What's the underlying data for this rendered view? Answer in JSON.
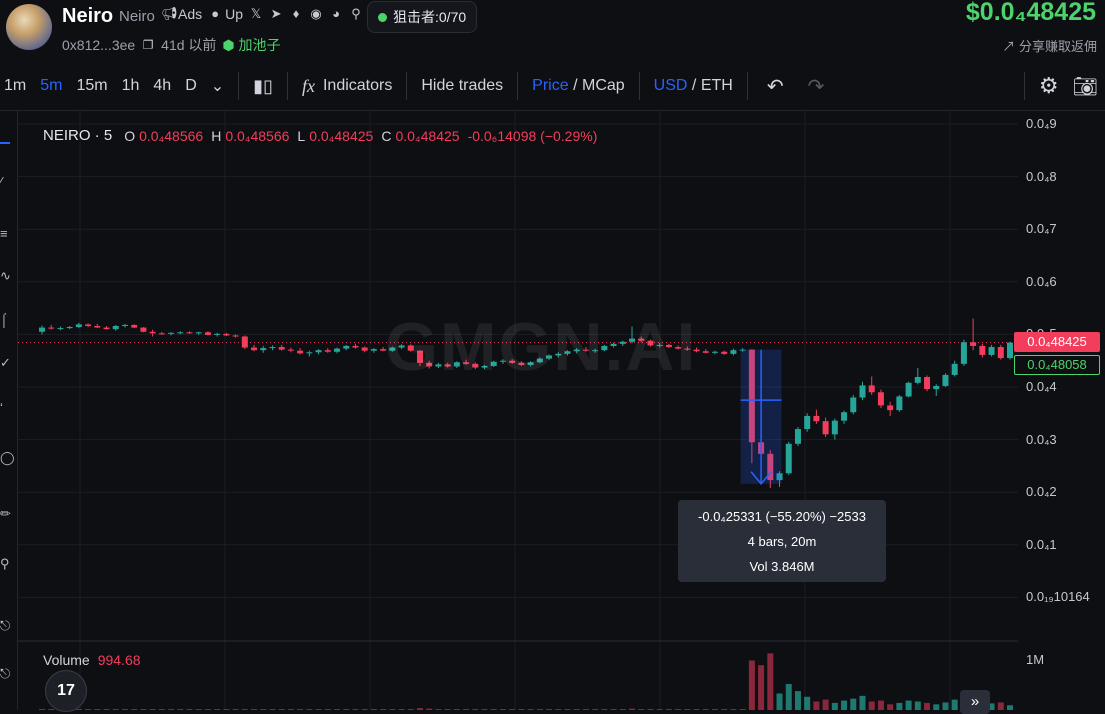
{
  "header": {
    "token_name": "Neiro",
    "token_sub": "Neiro",
    "links": [
      {
        "label": "Ads",
        "icon": "megaphone-icon"
      },
      {
        "label": "Up",
        "icon": "people-icon"
      },
      {
        "label": "",
        "icon": "x-logo-icon"
      },
      {
        "label": "",
        "icon": "telegram-icon"
      },
      {
        "label": "",
        "icon": "tag-icon"
      },
      {
        "label": "",
        "icon": "eye-icon"
      },
      {
        "label": "",
        "icon": "chrome-icon"
      },
      {
        "label": "",
        "icon": "search-icon"
      }
    ],
    "sniper": "狙击者:0/70",
    "address": "0x812...3ee",
    "age": "41d 以前",
    "pool": "加池子",
    "price": "$0.0₄48425",
    "share": "分享赚取返佣"
  },
  "toolbar": {
    "intervals": [
      "1m",
      "5m",
      "15m",
      "1h",
      "4h",
      "D"
    ],
    "active_interval": "5m",
    "indicators": "Indicators",
    "hide_trades": "Hide trades",
    "price": "Price",
    "mcap": "MCap",
    "usd": "USD",
    "eth": "ETH",
    "slash": "/"
  },
  "legend": {
    "symbol": "NEIRO · 5",
    "o_label": "O",
    "o": "0.0₄48566",
    "h_label": "H",
    "h": "0.0₄48566",
    "l_label": "L",
    "l": "0.0₄48425",
    "c_label": "C",
    "c": "0.0₄48425",
    "change": "-0.0₆14098 (−0.29%)"
  },
  "price_tag": "0.0₄48425",
  "price_tag2": "0.0₄48058",
  "tooltip": {
    "line1": "-0.0₄25331 (−55.20%) −2533",
    "line2": "4 bars, 20m",
    "line3": "Vol 3.846M"
  },
  "watermark": "GMGN.AI",
  "volume": {
    "label": "Volume",
    "value": "994.68",
    "axis": "1M"
  },
  "tv_logo": "17",
  "colors": {
    "up": "#26a69a",
    "down": "#f23d5c",
    "accent": "#2962ff",
    "green_text": "#4cd36b"
  },
  "chart_data": {
    "type": "candlestick",
    "y_ticks": [
      "0.0₄9",
      "0.0₄8",
      "0.0₄7",
      "0.0₄6",
      "0.0₄5",
      "0.0₄4",
      "0.0₄3",
      "0.0₄2",
      "0.0₄1",
      "0.0₁₉10164"
    ],
    "ylim": [
      0.0,
      9e-05
    ],
    "candles": [
      [
        50.5,
        51.7,
        50.0,
        51.3
      ],
      [
        51.3,
        51.8,
        50.9,
        51.1
      ],
      [
        51.1,
        51.5,
        50.8,
        51.2
      ],
      [
        51.2,
        51.6,
        51.0,
        51.4
      ],
      [
        51.4,
        52.2,
        51.2,
        51.9
      ],
      [
        51.9,
        52.1,
        51.4,
        51.6
      ],
      [
        51.6,
        52.0,
        51.2,
        51.3
      ],
      [
        51.3,
        51.6,
        50.9,
        51.0
      ],
      [
        51.0,
        51.8,
        50.7,
        51.6
      ],
      [
        51.6,
        52.0,
        51.3,
        51.8
      ],
      [
        51.8,
        51.9,
        51.2,
        51.3
      ],
      [
        51.3,
        51.4,
        50.4,
        50.5
      ],
      [
        50.5,
        50.9,
        49.6,
        50.2
      ],
      [
        50.2,
        50.5,
        49.9,
        50.1
      ],
      [
        50.1,
        50.4,
        49.8,
        50.3
      ],
      [
        50.3,
        50.6,
        50.0,
        50.4
      ],
      [
        50.4,
        50.6,
        50.1,
        50.2
      ],
      [
        50.2,
        50.5,
        49.9,
        50.4
      ],
      [
        50.4,
        50.6,
        49.8,
        49.9
      ],
      [
        49.9,
        50.3,
        49.6,
        50.1
      ],
      [
        50.1,
        50.3,
        49.7,
        49.8
      ],
      [
        49.8,
        50.0,
        49.4,
        49.6
      ],
      [
        49.6,
        49.8,
        47.2,
        47.5
      ],
      [
        47.5,
        48.0,
        46.8,
        47.0
      ],
      [
        47.0,
        47.8,
        46.5,
        47.4
      ],
      [
        47.4,
        47.9,
        47.0,
        47.6
      ],
      [
        47.6,
        48.0,
        46.9,
        47.1
      ],
      [
        47.1,
        47.5,
        46.6,
        46.9
      ],
      [
        46.9,
        47.4,
        46.2,
        46.4
      ],
      [
        46.4,
        46.9,
        45.8,
        46.6
      ],
      [
        46.6,
        47.2,
        46.2,
        47.0
      ],
      [
        47.0,
        47.4,
        46.5,
        46.7
      ],
      [
        46.7,
        47.5,
        46.4,
        47.3
      ],
      [
        47.3,
        48.0,
        47.0,
        47.8
      ],
      [
        47.8,
        48.2,
        47.3,
        47.5
      ],
      [
        47.5,
        47.7,
        46.6,
        46.9
      ],
      [
        46.9,
        47.4,
        46.5,
        47.2
      ],
      [
        47.2,
        47.6,
        46.8,
        46.9
      ],
      [
        46.9,
        47.7,
        46.7,
        47.5
      ],
      [
        47.5,
        48.1,
        47.2,
        47.9
      ],
      [
        47.9,
        48.1,
        46.7,
        46.9
      ],
      [
        46.9,
        47.0,
        44.0,
        44.6
      ],
      [
        44.6,
        45.0,
        43.5,
        43.9
      ],
      [
        43.9,
        44.6,
        43.6,
        44.3
      ],
      [
        44.3,
        44.6,
        43.7,
        43.9
      ],
      [
        43.9,
        44.9,
        43.6,
        44.7
      ],
      [
        44.7,
        45.2,
        44.2,
        44.4
      ],
      [
        44.4,
        44.7,
        43.4,
        43.7
      ],
      [
        43.7,
        44.2,
        43.4,
        44.0
      ],
      [
        44.0,
        45.0,
        43.8,
        44.8
      ],
      [
        44.8,
        45.3,
        44.4,
        45.0
      ],
      [
        45.0,
        45.3,
        44.4,
        44.6
      ],
      [
        44.6,
        44.9,
        44.0,
        44.2
      ],
      [
        44.2,
        44.9,
        43.9,
        44.7
      ],
      [
        44.7,
        45.6,
        44.5,
        45.4
      ],
      [
        45.4,
        46.2,
        45.1,
        46.0
      ],
      [
        46.0,
        46.6,
        45.6,
        46.3
      ],
      [
        46.3,
        47.0,
        46.0,
        46.8
      ],
      [
        46.8,
        47.4,
        46.4,
        47.1
      ],
      [
        47.1,
        47.6,
        46.7,
        46.9
      ],
      [
        46.9,
        47.3,
        46.5,
        47.0
      ],
      [
        47.0,
        48.0,
        46.8,
        47.8
      ],
      [
        47.8,
        48.4,
        47.5,
        48.2
      ],
      [
        48.2,
        48.8,
        47.8,
        48.6
      ],
      [
        48.6,
        51.5,
        48.3,
        49.2
      ],
      [
        49.2,
        49.6,
        48.5,
        48.8
      ],
      [
        48.8,
        49.0,
        47.7,
        47.9
      ],
      [
        47.9,
        48.4,
        47.5,
        48.0
      ],
      [
        48.0,
        48.2,
        47.4,
        47.6
      ],
      [
        47.6,
        47.9,
        47.1,
        47.3
      ],
      [
        47.3,
        47.7,
        46.9,
        47.1
      ],
      [
        47.1,
        47.5,
        46.6,
        46.8
      ],
      [
        46.8,
        47.2,
        46.4,
        46.5
      ],
      [
        46.5,
        46.9,
        46.2,
        46.7
      ],
      [
        46.7,
        46.9,
        46.1,
        46.3
      ],
      [
        46.3,
        47.3,
        46.0,
        47.0
      ],
      [
        47.0,
        47.4,
        46.7,
        47.1
      ],
      [
        47.1,
        47.2,
        25.5,
        29.5
      ],
      [
        29.5,
        31.0,
        26.8,
        27.3
      ],
      [
        27.3,
        28.0,
        20.8,
        22.3
      ],
      [
        22.3,
        24.0,
        21.0,
        23.6
      ],
      [
        23.6,
        29.6,
        23.3,
        29.2
      ],
      [
        29.2,
        32.4,
        28.8,
        32.0
      ],
      [
        32.0,
        35.0,
        31.5,
        34.5
      ],
      [
        34.5,
        35.7,
        33.0,
        33.5
      ],
      [
        33.5,
        34.2,
        30.5,
        31.0
      ],
      [
        31.0,
        34.0,
        30.0,
        33.6
      ],
      [
        33.6,
        35.5,
        33.0,
        35.2
      ],
      [
        35.2,
        38.5,
        34.8,
        38.0
      ],
      [
        38.0,
        41.0,
        37.5,
        40.3
      ],
      [
        40.3,
        42.0,
        38.5,
        39.0
      ],
      [
        39.0,
        39.5,
        36.0,
        36.5
      ],
      [
        36.5,
        37.2,
        34.5,
        35.6
      ],
      [
        35.6,
        38.5,
        35.3,
        38.2
      ],
      [
        38.2,
        41.0,
        38.0,
        40.8
      ],
      [
        40.8,
        43.6,
        40.5,
        41.9
      ],
      [
        41.9,
        42.2,
        39.2,
        39.6
      ],
      [
        39.6,
        40.5,
        38.3,
        40.2
      ],
      [
        40.2,
        42.6,
        40.0,
        42.3
      ],
      [
        42.3,
        45.0,
        42.0,
        44.4
      ],
      [
        44.4,
        49.0,
        44.0,
        48.5
      ],
      [
        48.5,
        53.0,
        47.0,
        47.8
      ],
      [
        47.8,
        48.2,
        45.6,
        46.1
      ],
      [
        46.1,
        48.0,
        45.8,
        47.6
      ],
      [
        47.6,
        48.0,
        45.2,
        45.5
      ],
      [
        45.5,
        48.6,
        45.2,
        48.43
      ]
    ],
    "volume_max": 1000000,
    "volumes": [
      [
        0.02,
        0
      ],
      [
        0.02,
        0
      ],
      [
        0.02,
        0
      ],
      [
        0.02,
        0
      ],
      [
        0.02,
        0
      ],
      [
        0.02,
        0
      ],
      [
        0.02,
        0
      ],
      [
        0.02,
        0
      ],
      [
        0.02,
        0
      ],
      [
        0.02,
        0
      ],
      [
        0.02,
        0
      ],
      [
        0.02,
        0
      ],
      [
        0.02,
        0
      ],
      [
        0.02,
        0
      ],
      [
        0.02,
        0
      ],
      [
        0.02,
        0
      ],
      [
        0.02,
        0
      ],
      [
        0.02,
        0
      ],
      [
        0.02,
        0
      ],
      [
        0.02,
        0
      ],
      [
        0.02,
        0
      ],
      [
        0.02,
        0
      ],
      [
        0.02,
        0
      ],
      [
        0.02,
        0
      ],
      [
        0.02,
        0
      ],
      [
        0.02,
        0
      ],
      [
        0.02,
        0
      ],
      [
        0.02,
        0
      ],
      [
        0.02,
        0
      ],
      [
        0.02,
        0
      ],
      [
        0.02,
        0
      ],
      [
        0.02,
        0
      ],
      [
        0.02,
        0
      ],
      [
        0.02,
        0
      ],
      [
        0.02,
        0
      ],
      [
        0.02,
        0
      ],
      [
        0.02,
        0
      ],
      [
        0.02,
        0
      ],
      [
        0.02,
        0
      ],
      [
        0.02,
        0
      ],
      [
        0.02,
        0
      ],
      [
        0.04,
        0
      ],
      [
        0.03,
        0
      ],
      [
        0.02,
        0
      ],
      [
        0.02,
        0
      ],
      [
        0.02,
        0
      ],
      [
        0.02,
        0
      ],
      [
        0.02,
        0
      ],
      [
        0.02,
        0
      ],
      [
        0.02,
        0
      ],
      [
        0.02,
        0
      ],
      [
        0.02,
        0
      ],
      [
        0.02,
        0
      ],
      [
        0.02,
        0
      ],
      [
        0.02,
        0
      ],
      [
        0.02,
        0
      ],
      [
        0.02,
        0
      ],
      [
        0.02,
        0
      ],
      [
        0.02,
        0
      ],
      [
        0.02,
        0
      ],
      [
        0.02,
        0
      ],
      [
        0.02,
        0
      ],
      [
        0.02,
        0
      ],
      [
        0.02,
        0
      ],
      [
        0.03,
        0
      ],
      [
        0.02,
        0
      ],
      [
        0.02,
        0
      ],
      [
        0.02,
        0
      ],
      [
        0.02,
        0
      ],
      [
        0.02,
        0
      ],
      [
        0.02,
        0
      ],
      [
        0.02,
        0
      ],
      [
        0.02,
        0
      ],
      [
        0.02,
        0
      ],
      [
        0.02,
        0
      ],
      [
        0.02,
        0
      ],
      [
        0.02,
        0
      ],
      [
        1.05,
        0
      ],
      [
        0.95,
        0
      ],
      [
        1.2,
        0
      ],
      [
        0.35,
        1
      ],
      [
        0.55,
        1
      ],
      [
        0.4,
        1
      ],
      [
        0.28,
        1
      ],
      [
        0.18,
        0
      ],
      [
        0.22,
        0
      ],
      [
        0.15,
        1
      ],
      [
        0.2,
        1
      ],
      [
        0.24,
        1
      ],
      [
        0.3,
        1
      ],
      [
        0.18,
        0
      ],
      [
        0.2,
        0
      ],
      [
        0.12,
        0
      ],
      [
        0.15,
        1
      ],
      [
        0.2,
        1
      ],
      [
        0.18,
        1
      ],
      [
        0.15,
        0
      ],
      [
        0.12,
        1
      ],
      [
        0.16,
        1
      ],
      [
        0.22,
        1
      ],
      [
        0.25,
        1
      ],
      [
        0.3,
        0
      ],
      [
        0.18,
        0
      ],
      [
        0.14,
        1
      ],
      [
        0.16,
        0
      ],
      [
        0.1,
        1
      ]
    ]
  }
}
